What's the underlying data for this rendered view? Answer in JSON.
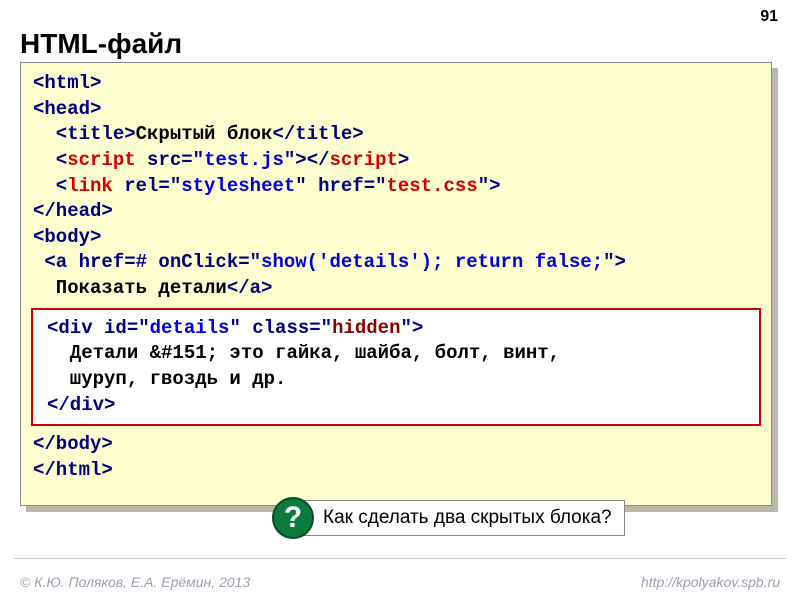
{
  "page_number": "91",
  "title": "HTML-файл",
  "code": {
    "l1_a": "<html>",
    "l2_a": "<head>",
    "l3_a": "  <title>",
    "l3_b": "Скрытый блок",
    "l3_c": "</title>",
    "l4_a": "  <",
    "l4_b": "script",
    "l4_c": " src=\"",
    "l4_d": "test.js",
    "l4_e": "\"></",
    "l4_f": "script",
    "l4_g": ">",
    "l5_a": "  <",
    "l5_b": "link",
    "l5_c": " rel=\"",
    "l5_d": "stylesheet",
    "l5_e": "\" href=\"",
    "l5_f": "test.css",
    "l5_g": "\">",
    "l6_a": "</head>",
    "l7_a": "<body>",
    "l8_a": " <a href=# onClick=\"",
    "l8_b": "show('details'); return false;",
    "l8_c": "\">",
    "l9_a": "  Показать детали",
    "l9_b": "</a>",
    "box_l1_a": "<div id=\"",
    "box_l1_b": "details",
    "box_l1_c": "\" class=\"",
    "box_l1_d": "hidden",
    "box_l1_e": "\">",
    "box_l2": "  Детали &#151; это гайка, шайба, болт, винт,",
    "box_l3": "  шуруп, гвоздь и др.",
    "box_l4": "</div>",
    "l10_a": "</body>",
    "l11_a": "</html>"
  },
  "question_mark": "?",
  "question_text": "Как сделать два скрытых блока?",
  "footer_left": "© К.Ю. Поляков, Е.А. Ерёмин, 2013",
  "footer_right": "http://kpolyakov.spb.ru"
}
